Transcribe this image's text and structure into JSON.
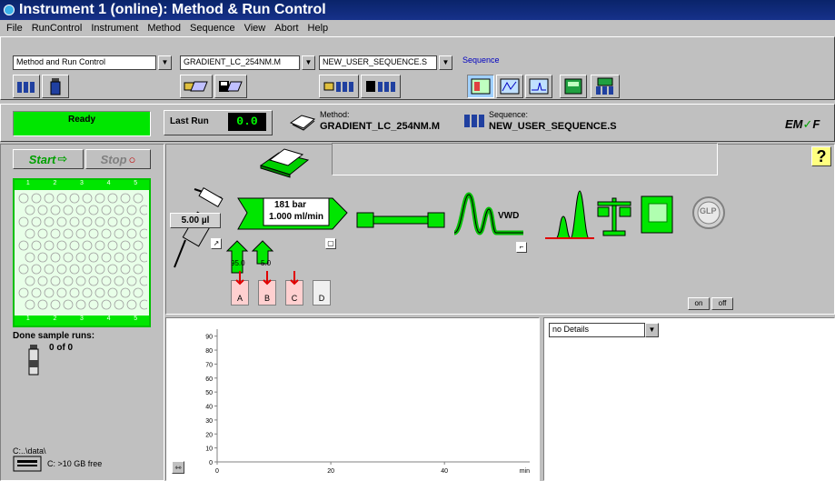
{
  "window": {
    "title": "Instrument 1 (online): Method & Run Control"
  },
  "menu": [
    "File",
    "RunControl",
    "Instrument",
    "Method",
    "Sequence",
    "View",
    "Abort",
    "Help"
  ],
  "toolbar": {
    "view_select": "Method and Run Control",
    "method_select": "GRADIENT_LC_254NM.M",
    "sequence_select": "NEW_USER_SEQUENCE.S",
    "sequence_group_label": "Sequence"
  },
  "status": {
    "ready_label": "Ready",
    "last_run_label": "Last Run",
    "last_run_value": "0.0",
    "method_caption": "Method:",
    "method_name": "GRADIENT_LC_254NM.M",
    "sequence_caption": "Sequence:",
    "sequence_name": "NEW_USER_SEQUENCE.S",
    "brand_logo": "EMF"
  },
  "controls": {
    "start_label": "Start",
    "stop_label": "Stop"
  },
  "tray": {
    "col_labels_top": [
      "1",
      "2",
      "3",
      "4",
      "5"
    ],
    "col_labels_bottom": [
      "1",
      "2",
      "3",
      "4",
      "5"
    ]
  },
  "samples": {
    "done_label": "Done sample runs:",
    "count": "0 of 0"
  },
  "disk": {
    "path": "C:..\\data\\",
    "free": "C: >10 GB free"
  },
  "instrument": {
    "injector_volume": "5.00 µl",
    "pump_pressure": "181 bar",
    "pump_flow": "1.000 ml/min",
    "solvent_a_pct": "95.0",
    "solvent_b_pct": "5.0",
    "bottles": [
      "A",
      "B",
      "C",
      "D"
    ],
    "detector_label": "VWD",
    "glp_label": "GLP",
    "on_label": "on",
    "off_label": "off",
    "help_label": "?"
  },
  "details": {
    "select_value": "no Details"
  },
  "chart_data": {
    "type": "line",
    "x": [],
    "series": [],
    "xlabel": "min",
    "ylabel": "",
    "xticks": [
      "0",
      "20",
      "40"
    ],
    "yticks": [
      "0",
      "10",
      "20",
      "30",
      "40",
      "50",
      "60",
      "70",
      "80",
      "90"
    ],
    "xlim": [
      0,
      55
    ],
    "ylim": [
      0,
      95
    ],
    "grid": false
  }
}
